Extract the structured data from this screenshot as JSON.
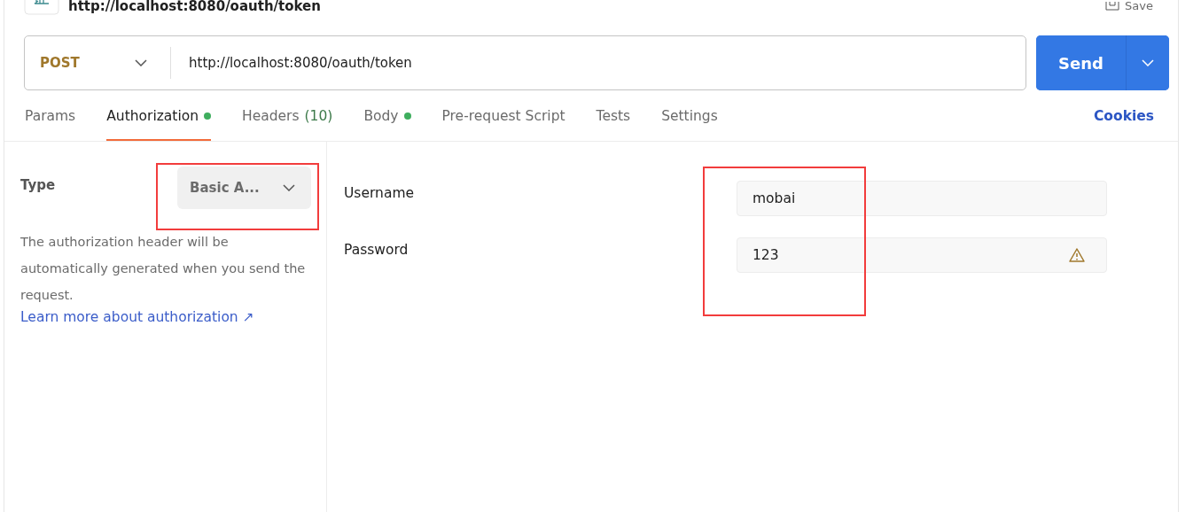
{
  "header": {
    "title": "http://localhost:8080/oauth/token",
    "save": "Save"
  },
  "request": {
    "method": "POST",
    "url": "http://localhost:8080/oauth/token",
    "send": "Send"
  },
  "tabs": [
    {
      "label": "Params",
      "selected": false,
      "dot": false
    },
    {
      "label": "Authorization",
      "selected": true,
      "dot": true
    },
    {
      "label": "Headers",
      "count": "(10)",
      "selected": false,
      "dot": false
    },
    {
      "label": "Body",
      "selected": false,
      "dot": true
    },
    {
      "label": "Pre-request Script",
      "selected": false,
      "dot": false
    },
    {
      "label": "Tests",
      "selected": false,
      "dot": false
    },
    {
      "label": "Settings",
      "selected": false,
      "dot": false
    }
  ],
  "cookies": "Cookies",
  "auth": {
    "type_label": "Type",
    "type_value": "Basic A...",
    "description": "The authorization header will be automatically generated when you send the request.",
    "learn_more": "Learn more about authorization ↗"
  },
  "fields": [
    {
      "label": "Username",
      "value": "mobai",
      "warning": false
    },
    {
      "label": "Password",
      "value": "123",
      "warning": true
    }
  ]
}
